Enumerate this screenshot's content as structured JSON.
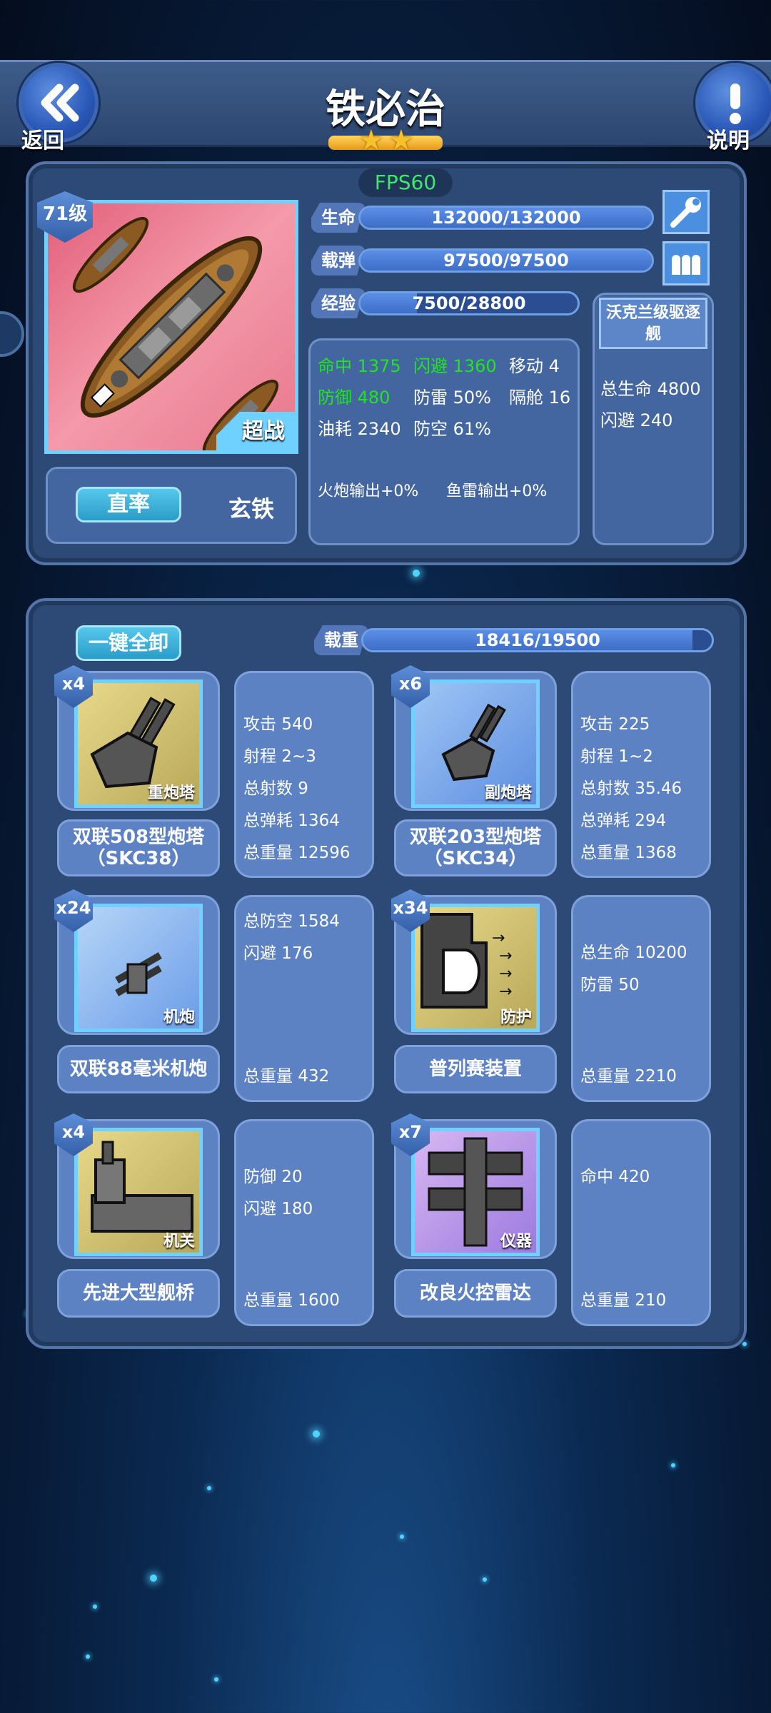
{
  "header": {
    "back_label": "返回",
    "title": "铁必治",
    "help_label": "说明",
    "stars_filled": 2,
    "fps": "FPS60"
  },
  "ship": {
    "level": "71级",
    "rarity": "超战",
    "mode": "直率",
    "material": "玄铁",
    "bars": [
      {
        "label": "生命",
        "text": "132000/132000",
        "fraction": 1.0
      },
      {
        "label": "载弹",
        "text": "97500/97500",
        "fraction": 1.0
      },
      {
        "label": "经验",
        "text": "7500/28800",
        "fraction": 0.26
      }
    ],
    "stats": [
      {
        "text": "命中 1375",
        "highlight": true
      },
      {
        "text": "闪避 1360",
        "highlight": true
      },
      {
        "text": "移动 4",
        "highlight": false
      },
      {
        "text": "防御 480",
        "highlight": true
      },
      {
        "text": "防雷 50%",
        "highlight": false
      },
      {
        "text": "隔舱 16",
        "highlight": false
      },
      {
        "text": "油耗 2340",
        "highlight": false
      },
      {
        "text": "防空 61%",
        "highlight": false
      }
    ],
    "outputs": [
      "火炮输出+0%",
      "鱼雷输出+0%"
    ],
    "escort": {
      "name": "沃克兰级驱逐舰",
      "stats": [
        "总生命 4800",
        "闪避 240"
      ]
    }
  },
  "loadout": {
    "unequip_all_label": "一键全卸",
    "capacity_label": "载重",
    "capacity_text": "18416/19500",
    "capacity_fraction": 0.944,
    "items": [
      {
        "count": "x4",
        "type": "重炮塔",
        "name": "双联508型炮塔（SKC38）",
        "stats": [
          "攻击 540",
          "射程 2~3",
          "总射数 9",
          "总弹耗 1364",
          "总重量 12596"
        ]
      },
      {
        "count": "x6",
        "type": "副炮塔",
        "name": "双联203型炮塔（SKC34）",
        "stats": [
          "攻击 225",
          "射程 1~2",
          "总射数 35.46",
          "总弹耗 294",
          "总重量 1368"
        ]
      },
      {
        "count": "x24",
        "type": "机炮",
        "name": "双联88毫米机炮",
        "stats": [
          "总防空 1584",
          "闪避 176"
        ],
        "weight": "总重量 432"
      },
      {
        "count": "x34",
        "type": "防护",
        "name": "普列赛装置",
        "stats": [
          "总生命 10200",
          "防雷 50"
        ],
        "weight": "总重量 2210"
      },
      {
        "count": "x4",
        "type": "机关",
        "name": "先进大型舰桥",
        "stats": [
          "防御 20",
          "闪避 180"
        ],
        "weight": "总重量 1600"
      },
      {
        "count": "x7",
        "type": "仪器",
        "name": "改良火控雷达",
        "stats": [
          "命中 420"
        ],
        "weight": "总重量 210"
      }
    ]
  },
  "colors": {
    "highlight": "#22e322",
    "accent": "#6fd1ff"
  }
}
